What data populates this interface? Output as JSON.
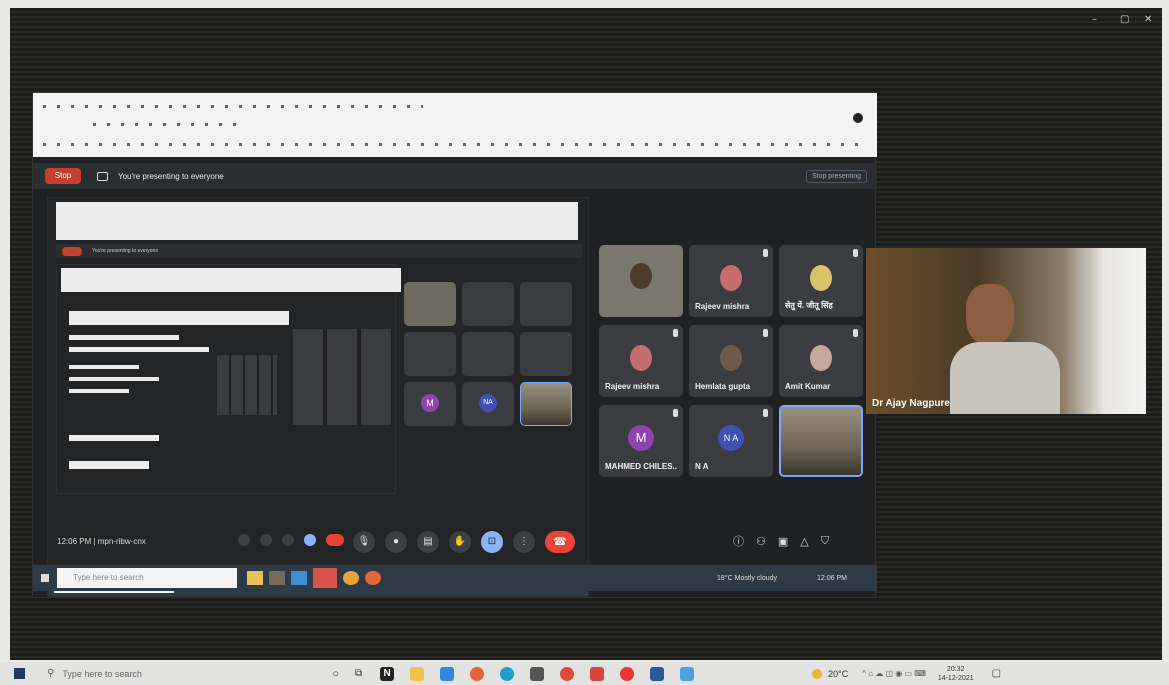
{
  "window_controls": {
    "minimize": "–",
    "maximize": "▢",
    "close": "✕"
  },
  "meet": {
    "stop_label": "Stop",
    "presenting_text": "You're presenting to everyone",
    "stop_presenting_label": "Stop presenting",
    "time_meeting": "12:06 PM  |  mpn-ribw-cnx"
  },
  "participants": [
    {
      "name": "Rajeev mishra"
    },
    {
      "name": "सेतु यें. जीतू सिंह"
    },
    {
      "name": "Rajeev mishra"
    },
    {
      "name": "Hemlata gupta"
    },
    {
      "name": "Amit Kumar"
    },
    {
      "name": "MAHMED CHILES...",
      "initial": "M"
    },
    {
      "name": "N A",
      "initial": "N A"
    }
  ],
  "speaker": {
    "name": "Dr Ajay Nagpure"
  },
  "inner_taskbar": {
    "search_placeholder": "Type here to search",
    "weather": "18°C  Mostly cloudy",
    "clock": "12:06 PM"
  },
  "taskbar": {
    "search_placeholder": "Type here to search",
    "weather": "20°C",
    "time": "20:32",
    "date": "14-12-2021"
  },
  "icons": [
    "windows-icon",
    "search-icon",
    "cortana-icon",
    "taskview-icon",
    "notion-icon",
    "files-icon",
    "photos-icon",
    "firefox-icon",
    "edge-icon",
    "store-icon",
    "chrome-icon",
    "app-icon",
    "opera-icon",
    "word-icon",
    "settings-icon",
    "notification-icon"
  ]
}
